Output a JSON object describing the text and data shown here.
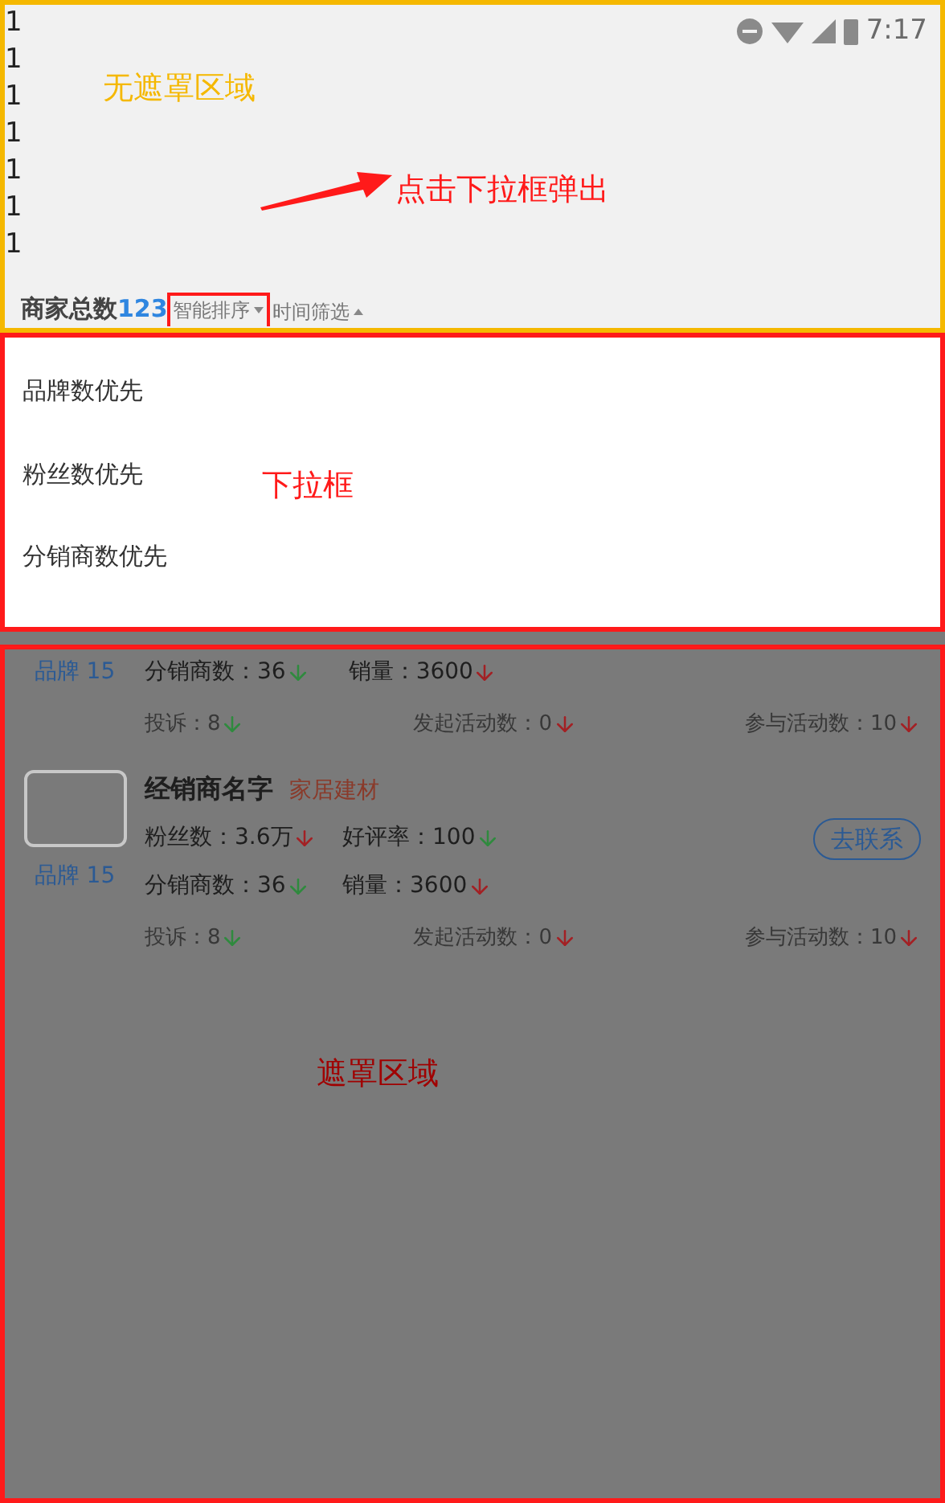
{
  "status_bar": {
    "time": "7:17"
  },
  "top": {
    "annotation": "无遮罩区域",
    "lines": [
      "1",
      "1",
      "1",
      "1",
      "1",
      "1",
      "1"
    ],
    "arrow_annotation": "点击下拉框弹出"
  },
  "header": {
    "total_label": "商家总数",
    "total_count": "123",
    "filters": [
      {
        "label": "智能排序",
        "expanded": true
      },
      {
        "label": "时间筛选",
        "expanded": false
      }
    ]
  },
  "dropdown": {
    "annotation": "下拉框",
    "options": [
      {
        "label": "品牌数优先"
      },
      {
        "label": "粉丝数优先"
      },
      {
        "label": "分销商数优先"
      }
    ]
  },
  "mask": {
    "annotation": "遮罩区域",
    "cards": [
      {
        "kind": "partial",
        "brand": "品牌 15",
        "rows": [
          [
            {
              "text": "分销商数：36",
              "color": "#2f8a3e"
            },
            {
              "text": "销量：3600",
              "color": "#a32024"
            }
          ]
        ],
        "footer": [
          {
            "text": "投诉：8",
            "color": "#2f8a3e"
          },
          {
            "text": "发起活动数：0",
            "color": "#a32024"
          },
          {
            "text": "参与活动数：10",
            "color": "#a32024"
          }
        ]
      },
      {
        "kind": "full",
        "name": "经销商名字",
        "category": "家居建材",
        "button": "去联系",
        "brand": "品牌 15",
        "rows": [
          [
            {
              "text": "粉丝数：3.6万",
              "color": "#a32024"
            },
            {
              "text": "好评率：100",
              "color": "#2f8a3e"
            }
          ],
          [
            {
              "text": "分销商数：36",
              "color": "#2f8a3e"
            },
            {
              "text": "销量：3600",
              "color": "#a32024"
            }
          ]
        ],
        "footer": [
          {
            "text": "投诉：8",
            "color": "#2f8a3e"
          },
          {
            "text": "发起活动数：0",
            "color": "#a32024"
          },
          {
            "text": "参与活动数：10",
            "color": "#a32024"
          }
        ]
      }
    ]
  }
}
